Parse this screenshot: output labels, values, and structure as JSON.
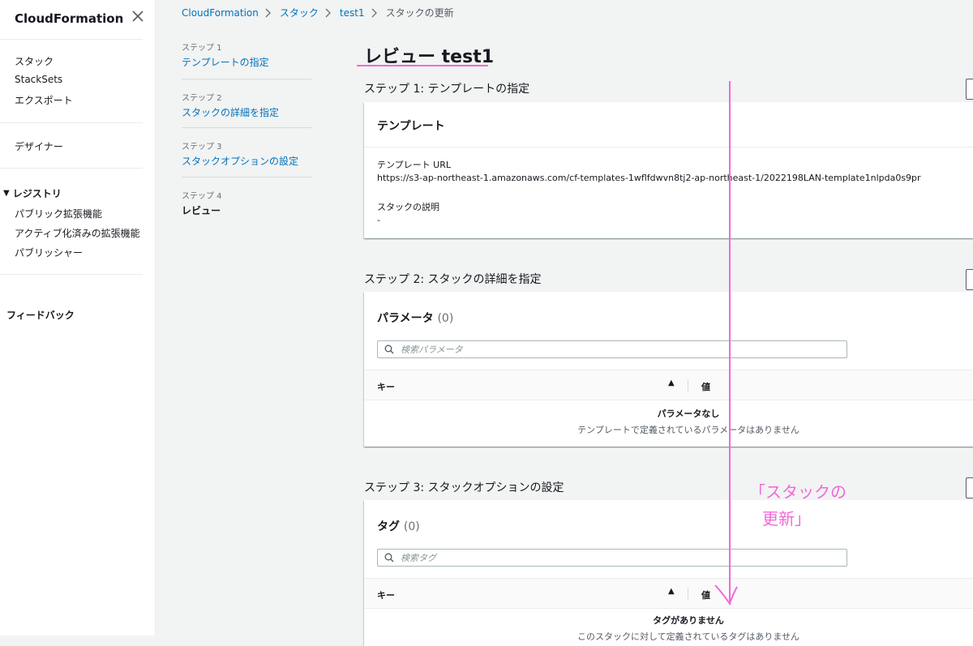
{
  "sidebar": {
    "title": "CloudFormation",
    "items_primary": [
      "スタック",
      "StackSets",
      "エクスポート"
    ],
    "designer": "デザイナー",
    "registry_section": "レジストリ",
    "registry_items": [
      "パブリック拡張機能",
      "アクティブ化済みの拡張機能",
      "パブリッシャー"
    ],
    "feedback": "フィードバック"
  },
  "breadcrumb": {
    "items": [
      "CloudFormation",
      "スタック",
      "test1"
    ],
    "current": "スタックの更新"
  },
  "steps_nav": [
    {
      "number": "ステップ 1",
      "label": "テンプレートの指定"
    },
    {
      "number": "ステップ 2",
      "label": "スタックの詳細を指定"
    },
    {
      "number": "ステップ 3",
      "label": "スタックオプションの設定"
    },
    {
      "number": "ステップ 4",
      "label": "レビュー"
    }
  ],
  "main": {
    "title": "レビュー test1",
    "step1": {
      "heading": "ステップ 1: テンプレートの指定",
      "card_title": "テンプレート",
      "url_label": "テンプレート URL",
      "url_value": "https://s3-ap-northeast-1.amazonaws.com/cf-templates-1wflfdwvn8tj2-ap-northeast-1/2022198LAN-template1nlpda0s9pr",
      "desc_label": "スタックの説明",
      "desc_value": "-"
    },
    "step2": {
      "heading": "ステップ 2: スタックの詳細を指定",
      "card_title": "パラメータ",
      "count": "(0)",
      "search_placeholder": "検索パラメータ",
      "col_key": "キー",
      "col_value": "値",
      "empty_title": "パラメータなし",
      "empty_desc": "テンプレートで定義されているパラメータはありません"
    },
    "step3": {
      "heading": "ステップ 3: スタックオプションの設定",
      "card_title": "タグ",
      "count": "(0)",
      "search_placeholder": "検索タグ",
      "col_key": "キー",
      "col_value": "値",
      "empty_title": "タグがありません",
      "empty_desc": "このスタックに対して定義されているタグはありません"
    }
  },
  "annotation": {
    "line1": "「スタックの",
    "line2": "更新」",
    "color": "#f06ad6"
  },
  "colors": {
    "link": "#0073bb",
    "text": "#16191f",
    "background": "#f2f3f3"
  }
}
